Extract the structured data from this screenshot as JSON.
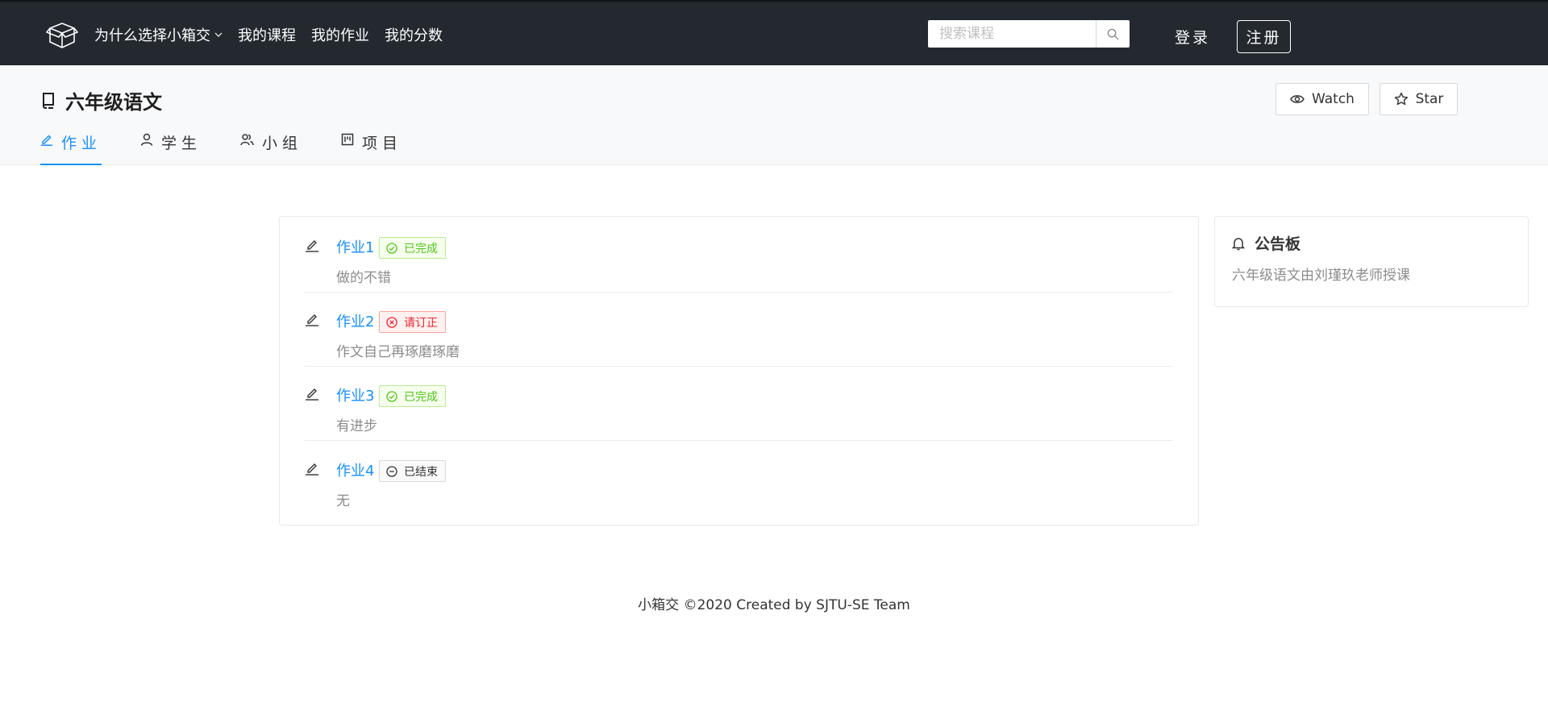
{
  "nav": {
    "items": [
      {
        "label": "为什么选择小箱交",
        "has_dropdown": true
      },
      {
        "label": "我的课程"
      },
      {
        "label": "我的作业"
      },
      {
        "label": "我的分数"
      }
    ],
    "search_placeholder": "搜索课程",
    "login_label": "登录",
    "register_label": "注册"
  },
  "course": {
    "title": "六年级语文",
    "watch_label": "Watch",
    "star_label": "Star",
    "tabs": [
      {
        "label": "作业",
        "icon": "edit-icon",
        "active": true
      },
      {
        "label": "学生",
        "icon": "user-icon"
      },
      {
        "label": "小组",
        "icon": "team-icon"
      },
      {
        "label": "项目",
        "icon": "project-icon"
      }
    ]
  },
  "homeworks": [
    {
      "title": "作业1",
      "status": "已完成",
      "status_type": "success",
      "comment": "做的不错"
    },
    {
      "title": "作业2",
      "status": "请订正",
      "status_type": "error",
      "comment": "作文自己再琢磨琢磨"
    },
    {
      "title": "作业3",
      "status": "已完成",
      "status_type": "success",
      "comment": "有进步"
    },
    {
      "title": "作业4",
      "status": "已结束",
      "status_type": "default",
      "comment": "无"
    }
  ],
  "board": {
    "title": "公告板",
    "text": "六年级语文由刘瑾玖老师授课"
  },
  "footer": {
    "text": "小箱交 ©2020 Created by SJTU-SE Team"
  },
  "colors": {
    "nav_bg": "#23292f",
    "accent": "#1890ff",
    "success": "#52c41a",
    "error": "#f5222d"
  }
}
